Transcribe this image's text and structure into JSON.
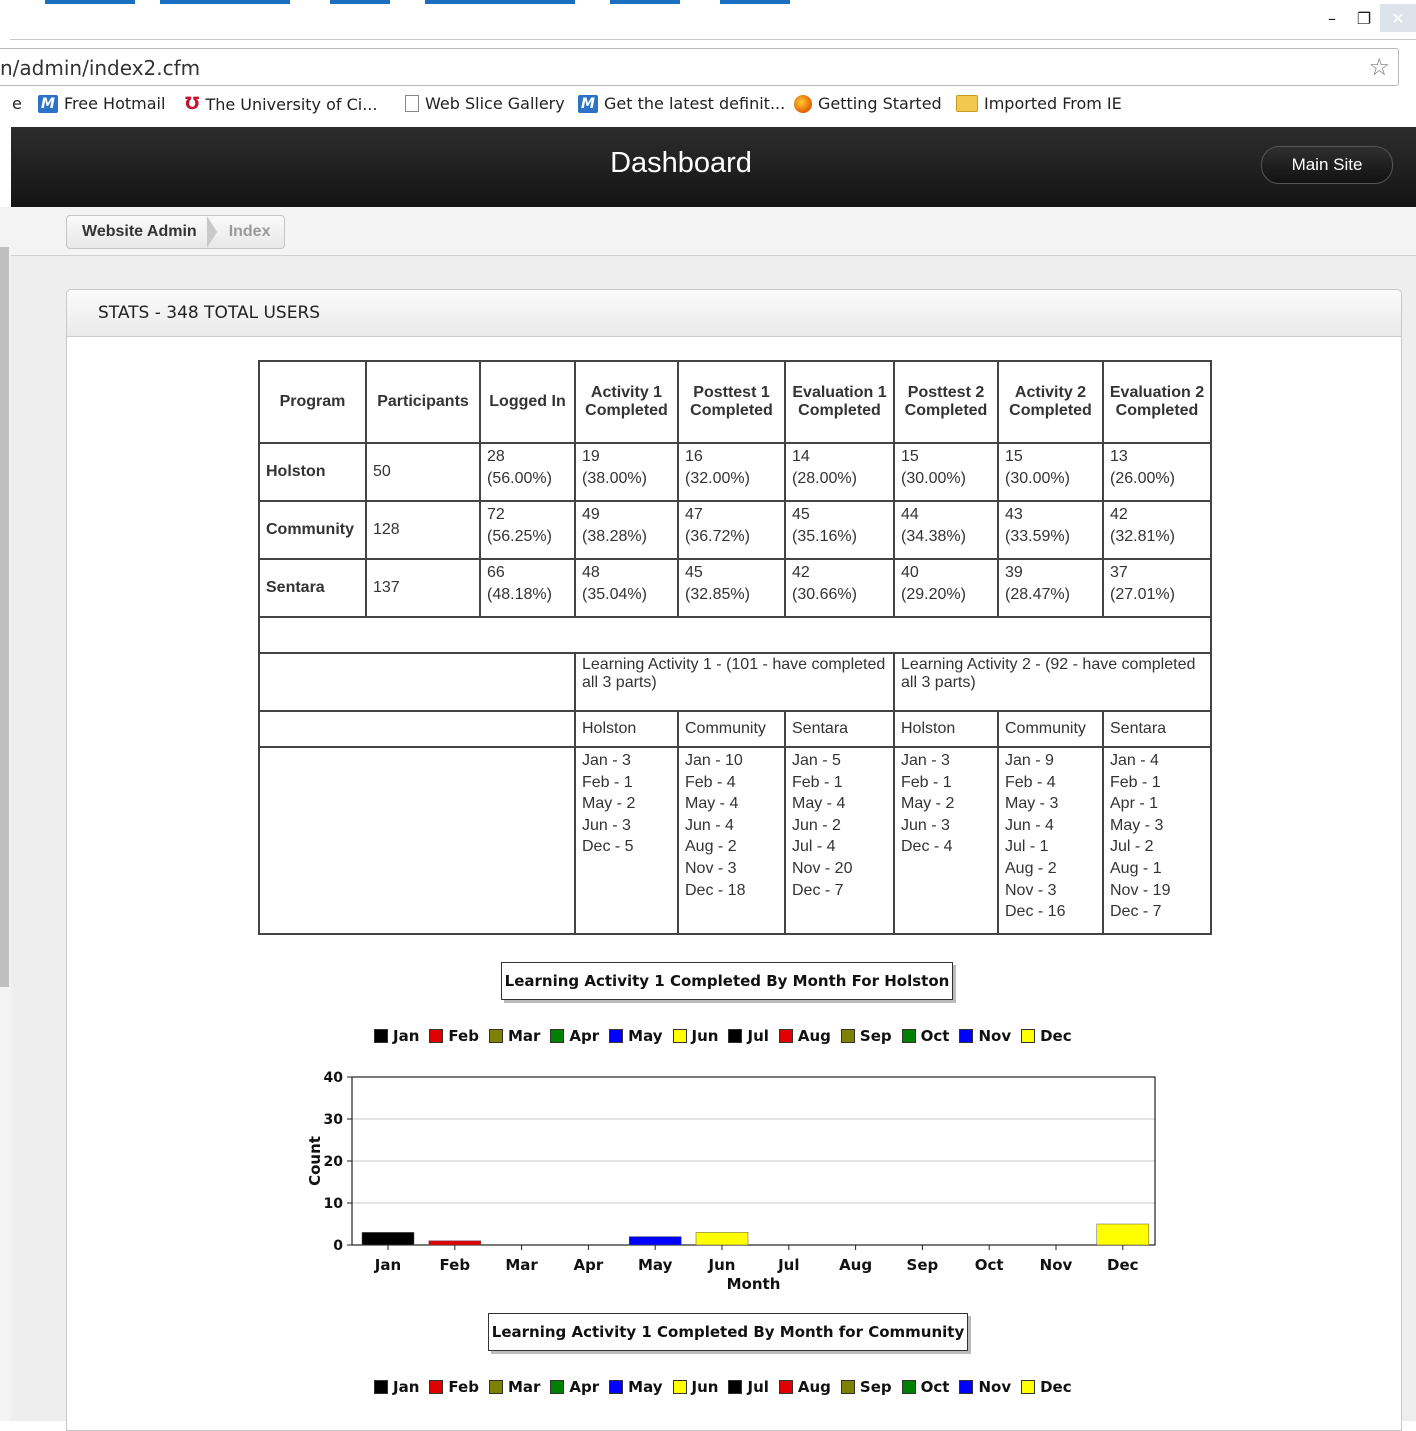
{
  "browser": {
    "url": "n/admin/index2.cfm",
    "window_buttons": {
      "minimize": "–",
      "restore": "❐",
      "close": "✕"
    },
    "bookmarks": [
      {
        "label": "e",
        "icon": "none"
      },
      {
        "label": "Free Hotmail",
        "icon": "msn-icon"
      },
      {
        "label": "The University of Ci...",
        "icon": "uc-icon"
      },
      {
        "label": "Web Slice Gallery",
        "icon": "page-icon"
      },
      {
        "label": "Get the latest definit...",
        "icon": "msn-icon"
      },
      {
        "label": "Getting Started",
        "icon": "firefox-icon"
      },
      {
        "label": "Imported From IE",
        "icon": "folder-icon"
      }
    ]
  },
  "navbar": {
    "title": "Dashboard",
    "main_site": "Main Site"
  },
  "breadcrumb": {
    "item1": "Website Admin",
    "item2": "Index"
  },
  "panel": {
    "title": "STATS - 348 TOTAL USERS"
  },
  "stats_table": {
    "headers": [
      "Program",
      "Participants",
      "Logged In",
      "Activity 1 Completed",
      "Posttest 1 Completed",
      "Evaluation 1 Completed",
      "Posttest 2 Completed",
      "Activity 2 Completed",
      "Evaluation 2 Completed"
    ],
    "rows": [
      {
        "program": "Holston",
        "participants": "50",
        "cells": [
          [
            "28",
            "(56.00%)"
          ],
          [
            "19",
            "(38.00%)"
          ],
          [
            "16",
            "(32.00%)"
          ],
          [
            "14",
            "(28.00%)"
          ],
          [
            "15",
            "(30.00%)"
          ],
          [
            "15",
            "(30.00%)"
          ],
          [
            "13",
            "(26.00%)"
          ]
        ]
      },
      {
        "program": "Community",
        "participants": "128",
        "cells": [
          [
            "72",
            "(56.25%)"
          ],
          [
            "49",
            "(38.28%)"
          ],
          [
            "47",
            "(36.72%)"
          ],
          [
            "45",
            "(35.16%)"
          ],
          [
            "44",
            "(34.38%)"
          ],
          [
            "43",
            "(33.59%)"
          ],
          [
            "42",
            "(32.81%)"
          ]
        ]
      },
      {
        "program": "Sentara",
        "participants": "137",
        "cells": [
          [
            "66",
            "(48.18%)"
          ],
          [
            "48",
            "(35.04%)"
          ],
          [
            "45",
            "(32.85%)"
          ],
          [
            "42",
            "(30.66%)"
          ],
          [
            "40",
            "(29.20%)"
          ],
          [
            "39",
            "(28.47%)"
          ],
          [
            "37",
            "(27.01%)"
          ]
        ]
      }
    ],
    "learning_activity_1": "Learning Activity 1 - (101 - have completed all 3 parts)",
    "learning_activity_2": "Learning Activity 2 - (92 - have completed all 3 parts)",
    "sub_headers": [
      "Holston",
      "Community",
      "Sentara",
      "Holston",
      "Community",
      "Sentara"
    ],
    "monthly": [
      [
        "Jan - 3",
        "Feb - 1",
        "May - 2",
        "Jun - 3",
        "Dec - 5"
      ],
      [
        "Jan - 10",
        "Feb - 4",
        "May - 4",
        "Jun - 4",
        "Aug - 2",
        "Nov - 3",
        "Dec - 18"
      ],
      [
        "Jan - 5",
        "Feb - 1",
        "May - 4",
        "Jun - 2",
        "Jul - 4",
        "Nov - 20",
        "Dec - 7"
      ],
      [
        "Jan - 3",
        "Feb - 1",
        "May - 2",
        "Jun - 3",
        "Dec - 4"
      ],
      [
        "Jan - 9",
        "Feb - 4",
        "May - 3",
        "Jun - 4",
        "Jul - 1",
        "Aug - 2",
        "Nov - 3",
        "Dec - 16"
      ],
      [
        "Jan - 4",
        "Feb - 1",
        "Apr - 1",
        "May - 3",
        "Jul - 2",
        "Aug - 1",
        "Nov - 19",
        "Dec - 7"
      ]
    ]
  },
  "legend_items": [
    {
      "label": "Jan",
      "color": "#000000"
    },
    {
      "label": "Feb",
      "color": "#e00000"
    },
    {
      "label": "Mar",
      "color": "#7f7f00"
    },
    {
      "label": "Apr",
      "color": "#008000"
    },
    {
      "label": "May",
      "color": "#0000ff"
    },
    {
      "label": "Jun",
      "color": "#ffff00"
    },
    {
      "label": "Jul",
      "color": "#000000"
    },
    {
      "label": "Aug",
      "color": "#e00000"
    },
    {
      "label": "Sep",
      "color": "#7f7f00"
    },
    {
      "label": "Oct",
      "color": "#008000"
    },
    {
      "label": "Nov",
      "color": "#0000ff"
    },
    {
      "label": "Dec",
      "color": "#ffff00"
    }
  ],
  "chart_data": [
    {
      "type": "bar",
      "title": "Learning Activity 1 Completed By Month For Holston",
      "categories": [
        "Jan",
        "Feb",
        "Mar",
        "Apr",
        "May",
        "Jun",
        "Jul",
        "Aug",
        "Sep",
        "Oct",
        "Nov",
        "Dec"
      ],
      "values": [
        3,
        1,
        0,
        0,
        2,
        3,
        0,
        0,
        0,
        0,
        0,
        5
      ],
      "colors": [
        "#000000",
        "#e00000",
        "#7f7f00",
        "#008000",
        "#0000ff",
        "#ffff00",
        "#000000",
        "#e00000",
        "#7f7f00",
        "#008000",
        "#0000ff",
        "#ffff00"
      ],
      "xlabel": "Month",
      "ylabel": "Count",
      "ylim": [
        0,
        40
      ],
      "yticks": [
        0,
        10,
        20,
        30,
        40
      ],
      "grid": true,
      "legend": "top"
    },
    {
      "type": "bar",
      "title": "Learning Activity 1 Completed By Month for Community",
      "legend": "top"
    }
  ]
}
